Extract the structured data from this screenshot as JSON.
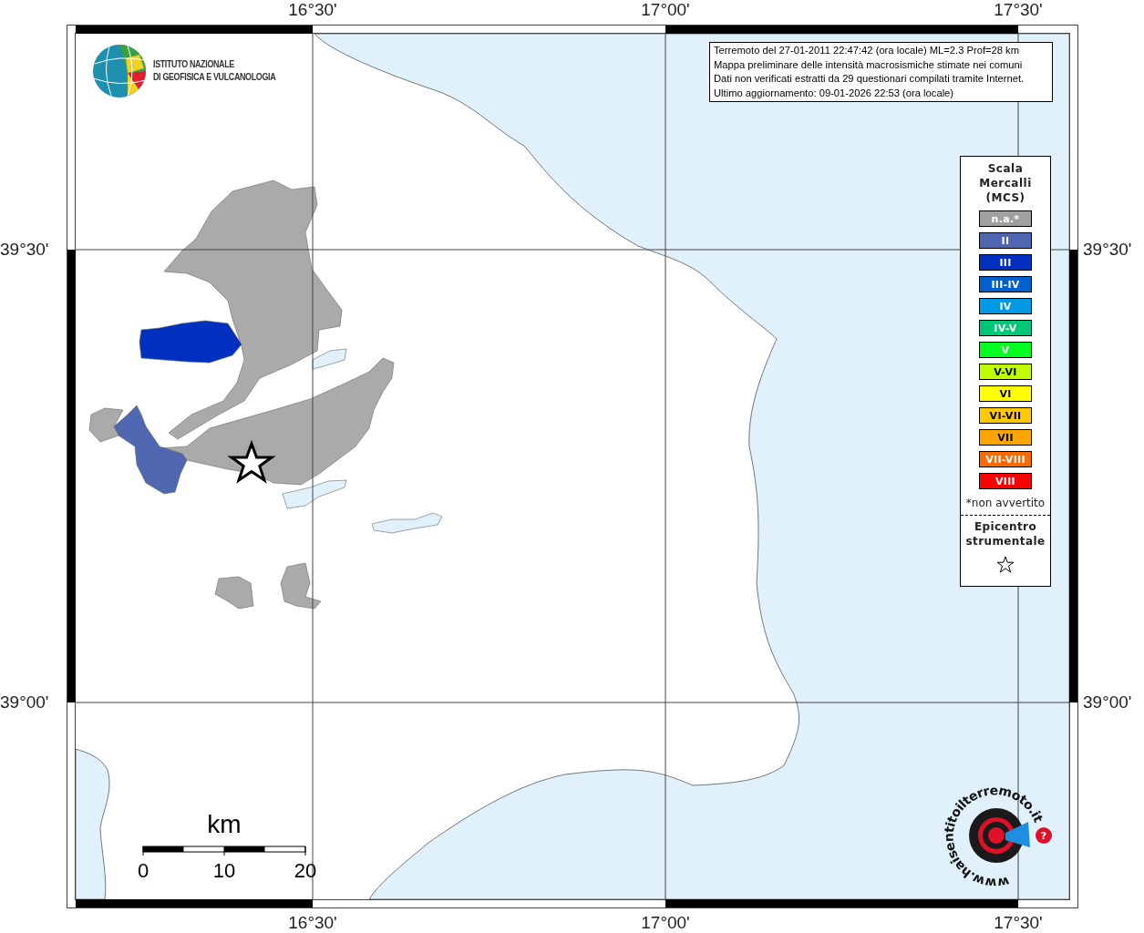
{
  "axes": {
    "top": [
      "16°30'",
      "17°00'",
      "17°30'"
    ],
    "bottom": [
      "16°30'",
      "17°00'",
      "17°30'"
    ],
    "left": [
      "39°30'",
      "39°00'"
    ],
    "right": [
      "39°30'",
      "39°00'"
    ]
  },
  "institute_logo": {
    "lines": [
      "ISTITUTO NAZIONALE",
      "DI GEOFISICA E VULCANOLOGIA"
    ]
  },
  "info_box": {
    "lines": [
      "Terremoto del 27-01-2011 22:47:42 (ora locale) ML=2.3 Prof=28 km",
      "Mappa preliminare delle intensità macrosismiche stimate nei comuni",
      "Dati non verificati estratti da 29 questionari compilati tramite Internet.",
      "Ultimo aggiornamento: 09-01-2026 22:53 (ora locale)"
    ]
  },
  "legend": {
    "title": "Scala Mercalli (MCS)",
    "items": [
      {
        "label": "n.a.*",
        "color": "#a0a0a0"
      },
      {
        "label": "II",
        "color": "#4f66b0"
      },
      {
        "label": "III",
        "color": "#0030c0"
      },
      {
        "label": "III-IV",
        "color": "#0060d0"
      },
      {
        "label": "IV",
        "color": "#0099e6"
      },
      {
        "label": "IV-V",
        "color": "#00c878"
      },
      {
        "label": "V",
        "color": "#00ff20"
      },
      {
        "label": "V-VI",
        "color": "#c0ff00"
      },
      {
        "label": "VI",
        "color": "#ffff00"
      },
      {
        "label": "VI-VII",
        "color": "#ffc800"
      },
      {
        "label": "VII",
        "color": "#ffa500"
      },
      {
        "label": "VII-VIII",
        "color": "#ff6a00"
      },
      {
        "label": "VIII",
        "color": "#ff0000"
      }
    ],
    "footnote": "*non avvertito",
    "epicenter_label": "Epicentro strumentale"
  },
  "scale_bar": {
    "unit": "km",
    "ticks": [
      "0",
      "10",
      "20"
    ]
  },
  "site_logo": {
    "text": "www.haisentitoilterremoto.it",
    "badge": "?"
  }
}
